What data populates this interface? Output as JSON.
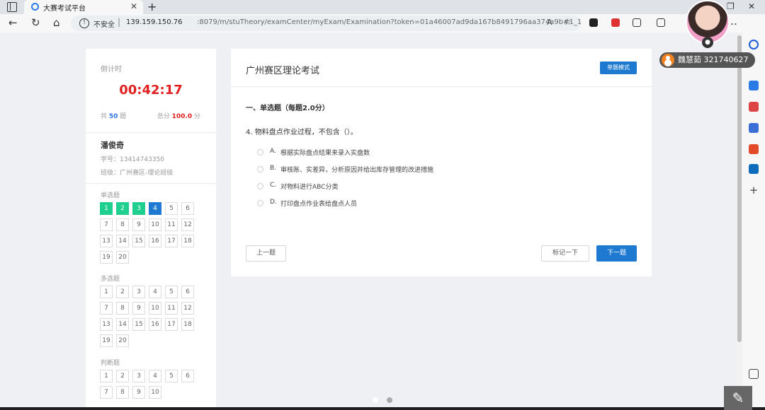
{
  "browser": {
    "tab_title": "大赛考试平台",
    "not_secure_label": "不安全",
    "url_host": "139.159.150.76",
    "url_path": ":8079/m/stuTheory/examCenter/myExam/Examination?token=01a46007ad9da167b8491796aa374a9b#1_1"
  },
  "sidebar": {
    "countdown_label": "倒计时",
    "countdown_time": "00:42:17",
    "total_prefix": "共",
    "total_count": "50",
    "total_suffix": "题",
    "score_prefix": "总分",
    "score_value": "100.0",
    "score_suffix": "分",
    "student_name": "潘俊奇",
    "student_id": "学号：13414743350",
    "student_class": "班级：广州赛区-理论班级",
    "sections": [
      {
        "label": "单选题",
        "questions": [
          "1",
          "2",
          "3",
          "4",
          "5",
          "6",
          "7",
          "8",
          "9",
          "10",
          "11",
          "12",
          "13",
          "14",
          "15",
          "16",
          "17",
          "18",
          "19",
          "20"
        ],
        "done": [
          1,
          2,
          3
        ],
        "current": 4
      },
      {
        "label": "多选题",
        "questions": [
          "1",
          "2",
          "3",
          "4",
          "5",
          "6",
          "7",
          "8",
          "9",
          "10",
          "11",
          "12",
          "13",
          "14",
          "15",
          "16",
          "17",
          "18",
          "19",
          "20"
        ],
        "done": [],
        "current": 0
      },
      {
        "label": "判断题",
        "questions": [
          "1",
          "2",
          "3",
          "4",
          "5",
          "6",
          "7",
          "8",
          "9",
          "10"
        ],
        "done": [],
        "current": 0
      }
    ]
  },
  "main": {
    "exam_title": "广州赛区理论考试",
    "mode_button": "单题模式",
    "section_heading": "一、单选题（每题2.0分）",
    "question": "4.  物料盘点作业过程，不包含（）。",
    "options": [
      {
        "letter": "A.",
        "text": "根据实际盘点结果来录入实盘数"
      },
      {
        "letter": "B.",
        "text": "审核账、实差异，分析原因并给出库存管理的改进措施"
      },
      {
        "letter": "C.",
        "text": "对物料进行ABC分类"
      },
      {
        "letter": "D.",
        "text": "打印盘点作业表给盘点人员"
      }
    ],
    "prev_button": "上一题",
    "mark_button": "标记一下",
    "next_button": "下一题"
  },
  "overlay": {
    "user_label": "魏慧茹 321740627"
  },
  "colors": {
    "accent": "#1e7ad1",
    "done": "#1fcf8f",
    "countdown": "#e02020"
  }
}
